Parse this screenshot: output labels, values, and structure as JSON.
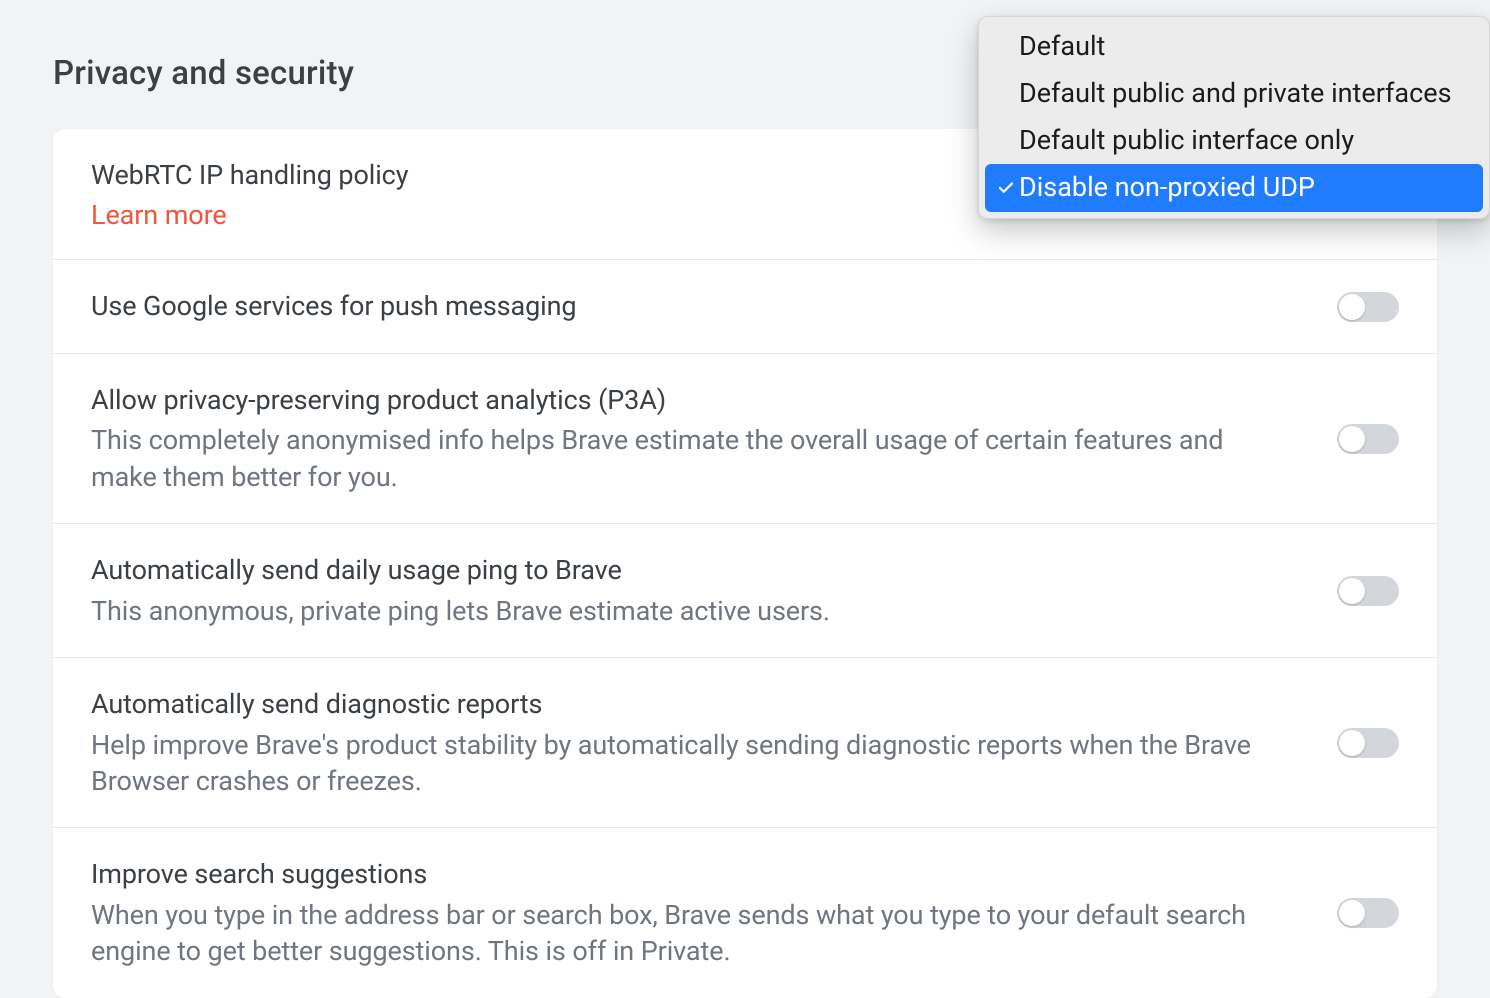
{
  "section_title": "Privacy and security",
  "rows": {
    "webrtc": {
      "title": "WebRTC IP handling policy",
      "learn_more": "Learn more"
    },
    "push": {
      "title": "Use Google services for push messaging"
    },
    "p3a": {
      "title": "Allow privacy-preserving product analytics (P3A)",
      "desc": "This completely anonymised info helps Brave estimate the overall usage of certain features and make them better for you."
    },
    "ping": {
      "title": "Automatically send daily usage ping to Brave",
      "desc": "This anonymous, private ping lets Brave estimate active users."
    },
    "diag": {
      "title": "Automatically send diagnostic reports",
      "desc": "Help improve Brave's product stability by automatically sending diagnostic reports when the Brave Browser crashes or freezes."
    },
    "search": {
      "title": "Improve search suggestions",
      "desc": "When you type in the address bar or search box, Brave sends what you type to your default search engine to get better suggestions. This is off in Private."
    }
  },
  "dropdown": {
    "items": [
      {
        "label": "Default",
        "selected": false
      },
      {
        "label": "Default public and private interfaces",
        "selected": false
      },
      {
        "label": "Default public interface only",
        "selected": false
      },
      {
        "label": "Disable non-proxied UDP",
        "selected": true
      }
    ]
  }
}
